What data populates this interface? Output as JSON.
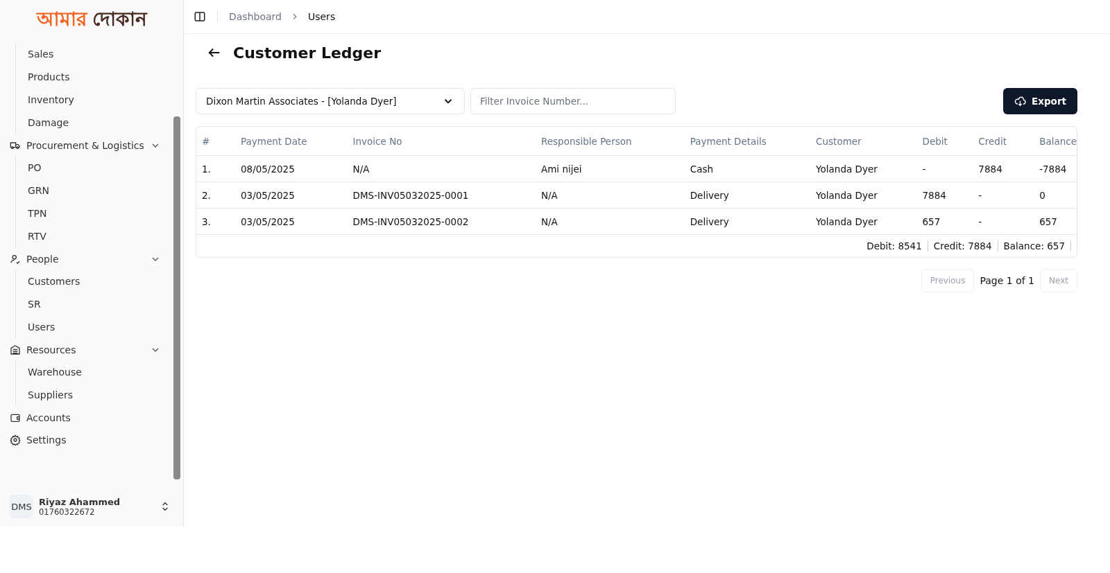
{
  "logo": {
    "part_1": "আমার",
    "part_2": "দোকান"
  },
  "sidebar": {
    "groups": [
      {
        "children": [
          "Sales",
          "Products",
          "Inventory",
          "Damage"
        ]
      },
      {
        "label": "Procurement & Logistics",
        "expanded": true,
        "children": [
          "PO",
          "GRN",
          "TPN",
          "RTV"
        ]
      },
      {
        "label": "People",
        "expanded": true,
        "children": [
          "Customers",
          "SR",
          "Users"
        ]
      },
      {
        "label": "Resources",
        "expanded": true,
        "children": [
          "Warehouse",
          "Suppliers"
        ]
      },
      {
        "label": "Accounts"
      },
      {
        "label": "Settings"
      }
    ],
    "user": {
      "avatar": "DMS",
      "name": "Riyaz Ahammed",
      "phone": "01760322672"
    }
  },
  "breadcrumb": [
    "Dashboard",
    "Users"
  ],
  "page_title": "Customer Ledger",
  "customer_select": {
    "value": "Dixon Martin Associates - [Yolanda Dyer]"
  },
  "invoice_filter": {
    "placeholder": "Filter Invoice Number..."
  },
  "export_button": "Export",
  "table": {
    "columns": [
      "#",
      "Payment Date",
      "Invoice No",
      "Responsible Person",
      "Payment Details",
      "Customer",
      "Debit",
      "Credit",
      "Balance"
    ],
    "rows": [
      [
        "1.",
        "08/05/2025",
        "N/A",
        "Ami nijei",
        "Cash",
        "Yolanda Dyer",
        "-",
        "7884",
        "-7884"
      ],
      [
        "2.",
        "03/05/2025",
        "DMS-INV05032025-0001",
        "N/A",
        "Delivery",
        "Yolanda Dyer",
        "7884",
        "-",
        "0"
      ],
      [
        "3.",
        "03/05/2025",
        "DMS-INV05032025-0002",
        "N/A",
        "Delivery",
        "Yolanda Dyer",
        "657",
        "-",
        "657"
      ]
    ],
    "totals": [
      "Debit: 8541",
      "Credit: 7884",
      "Balance: 657"
    ]
  },
  "pagination": {
    "previous": {
      "label": "Previous",
      "disabled": true
    },
    "page": "Page 1 of 1",
    "next": {
      "label": "Next",
      "disabled": true
    }
  }
}
